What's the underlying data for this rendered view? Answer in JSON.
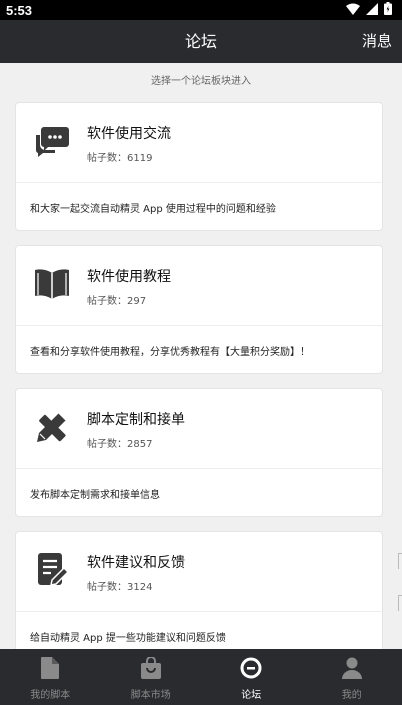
{
  "status_bar": {
    "time": "5:53"
  },
  "header": {
    "title": "论坛",
    "action_label": "消息"
  },
  "hint": "选择一个论坛板块进入",
  "boards": [
    {
      "title": "软件使用交流",
      "count_label": "帖子数：",
      "count": "6119",
      "description": "和大家一起交流自动精灵 App 使用过程中的问题和经验",
      "icon": "chat-bubbles-icon"
    },
    {
      "title": "软件使用教程",
      "count_label": "帖子数：",
      "count": "297",
      "description": "查看和分享软件使用教程，分享优秀教程有【大量积分奖励】！",
      "icon": "open-book-icon"
    },
    {
      "title": "脚本定制和接单",
      "count_label": "帖子数：",
      "count": "2857",
      "description": "发布脚本定制需求和接单信息",
      "icon": "ruler-pencil-icon"
    },
    {
      "title": "软件建议和反馈",
      "count_label": "帖子数：",
      "count": "3124",
      "description": "给自动精灵 App 提一些功能建议和问题反馈",
      "icon": "document-edit-icon"
    }
  ],
  "bottom_nav": [
    {
      "label": "我的脚本",
      "icon": "file-icon",
      "active": false
    },
    {
      "label": "脚本市场",
      "icon": "shopping-bag-icon",
      "active": false
    },
    {
      "label": "论坛",
      "icon": "forum-icon",
      "active": true
    },
    {
      "label": "我的",
      "icon": "person-icon",
      "active": false
    }
  ],
  "colors": {
    "bar": "#2a2b2e",
    "background": "#f0f0f0",
    "icon": "#3a3a3a",
    "nav_inactive": "#8a8a8a",
    "nav_active": "#ffffff"
  }
}
